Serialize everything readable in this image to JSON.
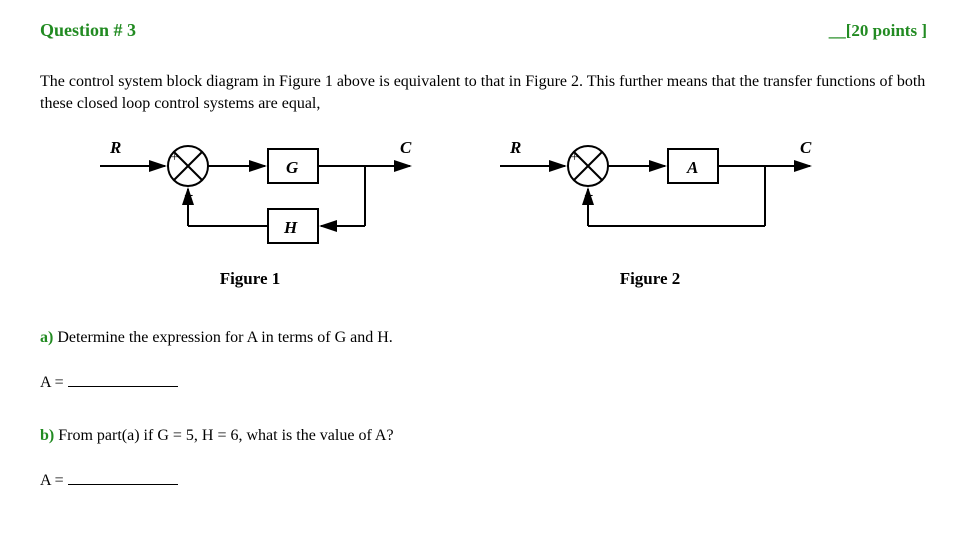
{
  "header": {
    "title": "Question # 3",
    "points_prefix": "__[",
    "points": "20 points",
    "points_suffix": " ]"
  },
  "intro": "The control system block diagram in Figure 1 above is equivalent to that in Figure 2. This further means that the transfer functions of both these closed loop control systems are equal,",
  "figure1": {
    "label": "Figure 1",
    "R": "R",
    "C": "C",
    "G": "G",
    "H": "H",
    "plus": "+",
    "minus": "_"
  },
  "figure2": {
    "label": "Figure 2",
    "R": "R",
    "C": "C",
    "A": "A",
    "plus": "+",
    "minus": "_"
  },
  "partA": {
    "letter": "a)",
    "text": " Determine the expression for A in terms of G and H.",
    "answer_label": "A = "
  },
  "partB": {
    "letter": "b)",
    "text": " From part(a) if G = 5, H = 6, what is the value of A?",
    "answer_label": "A = "
  }
}
